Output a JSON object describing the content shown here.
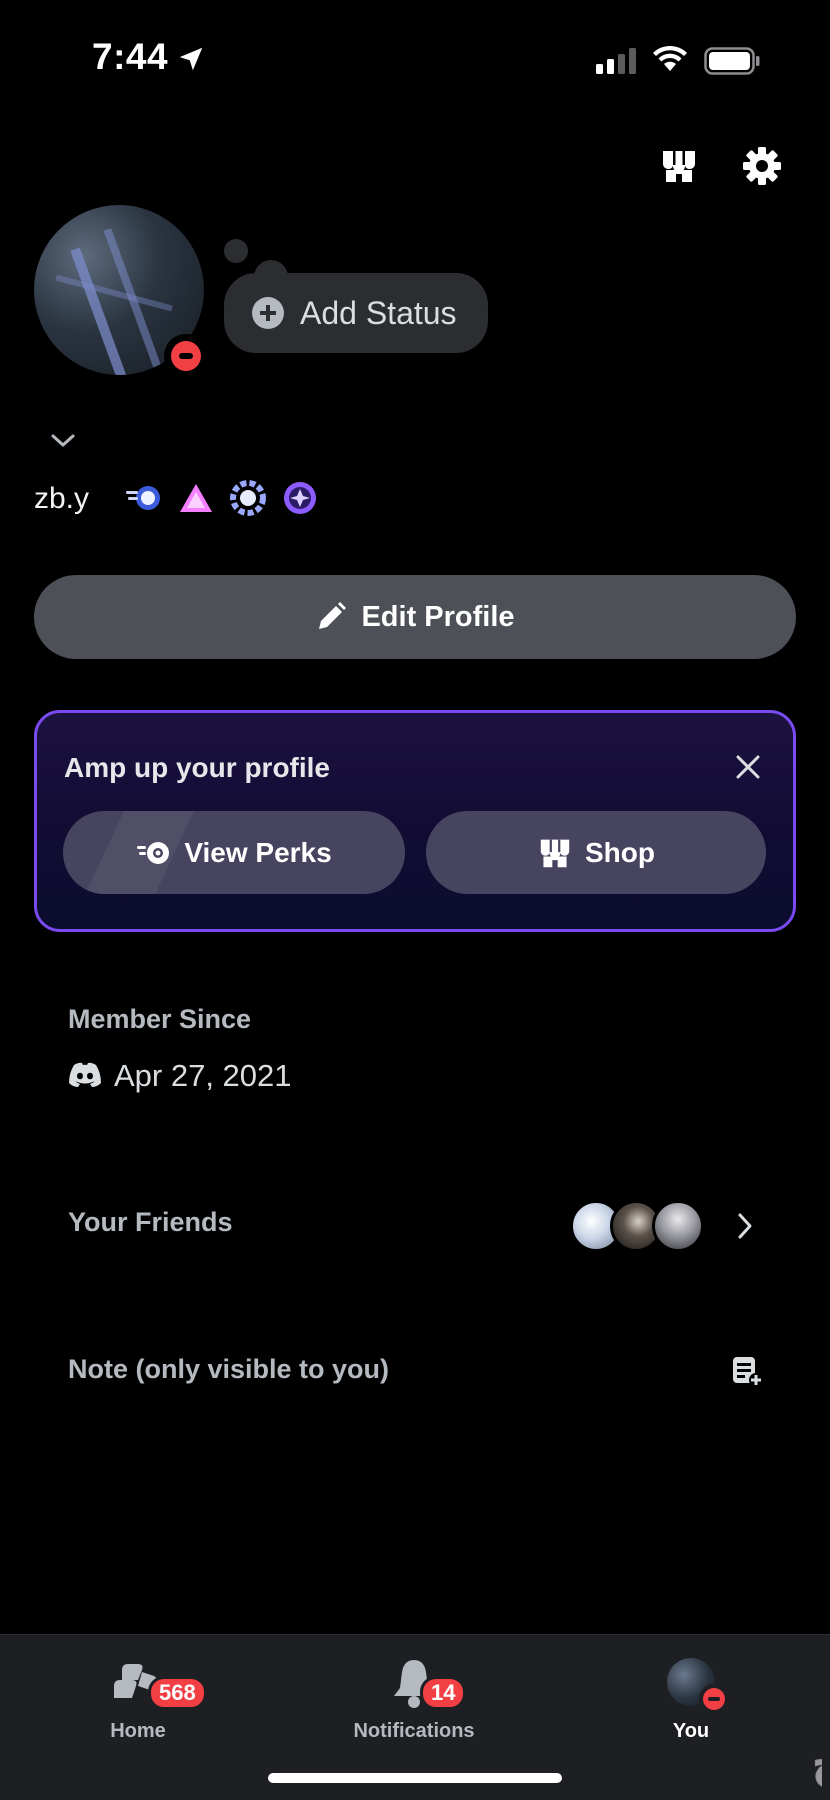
{
  "status_bar": {
    "time": "7:44"
  },
  "profile": {
    "username": "zb.y",
    "add_status_label": "Add Status",
    "badges": [
      "speed-badge-icon",
      "triangle-badge-icon",
      "laurel-badge-icon",
      "diamond-badge-icon"
    ],
    "edit_profile_label": "Edit Profile"
  },
  "amp_card": {
    "title": "Amp up your profile",
    "view_perks_label": "View Perks",
    "shop_label": "Shop"
  },
  "member_since": {
    "label": "Member Since",
    "date": "Apr 27, 2021"
  },
  "friends": {
    "label": "Your Friends"
  },
  "note": {
    "label": "Note (only visible to you)"
  },
  "tabs": [
    {
      "label": "Home",
      "badge": "568"
    },
    {
      "label": "Notifications",
      "badge": "14"
    },
    {
      "label": "You"
    }
  ],
  "watermark": "حراج",
  "colors": {
    "background": "#000000",
    "accent_border": "#7a4bf0",
    "dnd_red": "#f23f43",
    "button_gray": "#4e5058"
  }
}
